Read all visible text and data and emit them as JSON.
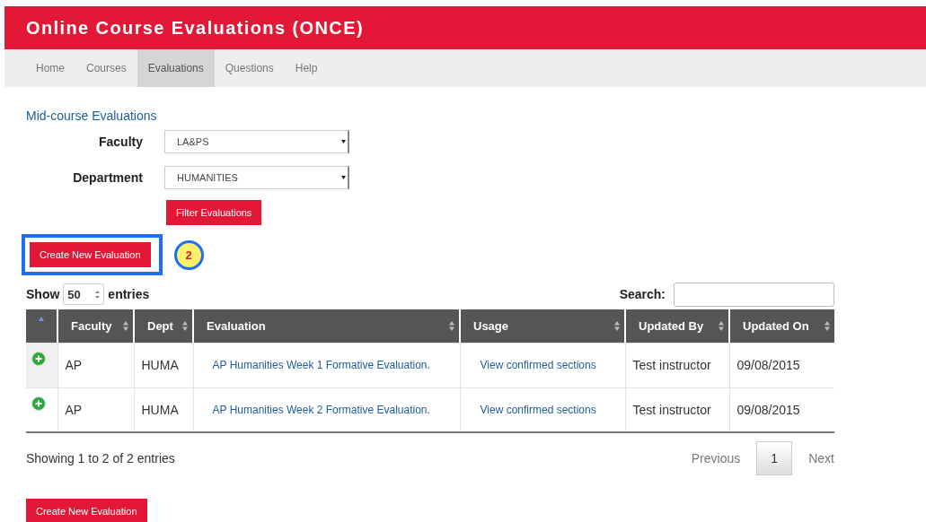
{
  "header": {
    "title": "Online Course Evaluations (ONCE)"
  },
  "nav": [
    {
      "label": "Home",
      "selected": false
    },
    {
      "label": "Courses",
      "selected": false
    },
    {
      "label": "Evaluations",
      "selected": true
    },
    {
      "label": "Questions",
      "selected": false
    },
    {
      "label": "Help",
      "selected": false
    }
  ],
  "section_title": "Mid-course Evaluations",
  "filters": [
    {
      "label": "Faculty",
      "value": "LA&PS"
    },
    {
      "label": "Department",
      "value": "HUMANITIES"
    }
  ],
  "filter_button": "Filter Evaluations",
  "create_button": "Create New Evaluation",
  "annotation": {
    "label": "2"
  },
  "length": {
    "before": "Show",
    "value": "50",
    "after": "entries"
  },
  "search": {
    "label": "Search:"
  },
  "table": {
    "columns": [
      {
        "sorted": true
      },
      {
        "label": "Faculty",
        "sorted": false
      },
      {
        "label": "Dept",
        "sorted": false
      },
      {
        "label": "Evaluation",
        "sorted": false
      },
      {
        "label": "Usage",
        "sorted": false
      },
      {
        "label": "Updated By",
        "sorted": false
      },
      {
        "label": "Updated On",
        "sorted": false
      }
    ],
    "rows": [
      {
        "faculty": "AP",
        "dept": "HUMA",
        "evaluation": "AP Humanities Week 1 Formative Evaluation.",
        "usage": "View confirmed sections",
        "updated_by": "Test instructor",
        "updated_on": "09/08/2015"
      },
      {
        "faculty": "AP",
        "dept": "HUMA",
        "evaluation": "AP Humanities Week 2 Formative Evaluation.",
        "usage": "View confirmed sections",
        "updated_by": "Test instructor",
        "updated_on": "09/08/2015"
      }
    ]
  },
  "info": "Showing 1 to 2 of 2 entries",
  "pagination": {
    "previous": "Previous",
    "pages": [
      {
        "label": "1",
        "selected": true
      }
    ],
    "next": "Next"
  },
  "bottom_button": "Create New Evaluation"
}
